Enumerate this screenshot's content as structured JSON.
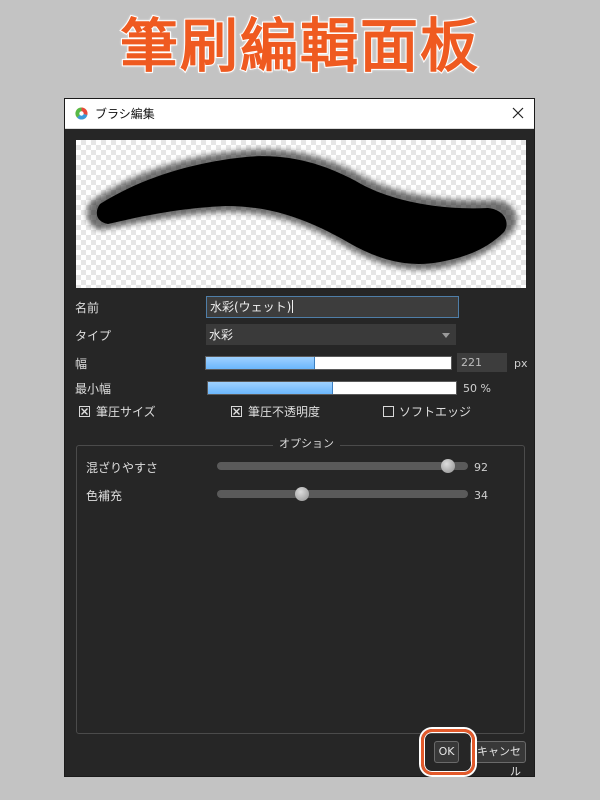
{
  "heading": "筆刷編輯面板",
  "dialog": {
    "title": "ブラシ編集",
    "close_label": "×"
  },
  "fields": {
    "name_label": "名前",
    "name_value": "水彩(ウェット)",
    "type_label": "タイプ",
    "type_value": "水彩",
    "width_label": "幅",
    "width_value": "221",
    "width_unit": "px",
    "width_fraction": 0.44,
    "min_width_label": "最小幅",
    "min_width_value_text": "50 %",
    "min_width_value": 50
  },
  "checkboxes": [
    {
      "label": "筆圧サイズ",
      "checked": true
    },
    {
      "label": "筆圧不透明度",
      "checked": true
    },
    {
      "label": "ソフトエッジ",
      "checked": false
    }
  ],
  "options": {
    "title": "オプション",
    "sliders": [
      {
        "label": "混ざりやすさ",
        "value": 92,
        "value_text": "92"
      },
      {
        "label": "色補充",
        "value": 34,
        "value_text": "34"
      }
    ]
  },
  "buttons": {
    "ok": "OK",
    "cancel": "キャンセル"
  },
  "colors": {
    "accent_fill": "#6bb6fb",
    "highlight": "#e35a2b",
    "heading": "#ef5a20"
  }
}
